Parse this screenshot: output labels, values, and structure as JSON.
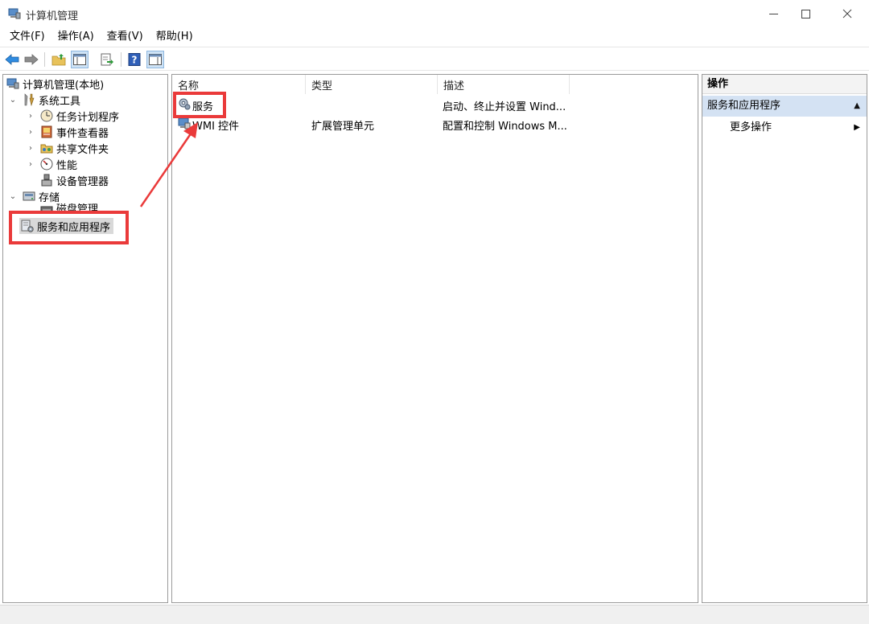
{
  "window": {
    "title": "计算机管理",
    "app_icon": "computer-management-icon"
  },
  "menu": [
    {
      "label": "文件(F)"
    },
    {
      "label": "操作(A)"
    },
    {
      "label": "查看(V)"
    },
    {
      "label": "帮助(H)"
    }
  ],
  "toolbar": {
    "icons": [
      "back-arrow-icon",
      "forward-arrow-icon",
      "up-folder-icon",
      "show-hide-tree-icon",
      "export-list-icon",
      "help-icon",
      "show-hide-action-pane-icon"
    ]
  },
  "tree": {
    "root": "计算机管理(本地)",
    "system_tools": "系统工具",
    "task_scheduler": "任务计划程序",
    "event_viewer": "事件查看器",
    "shared_folders": "共享文件夹",
    "performance": "性能",
    "device_manager": "设备管理器",
    "storage": "存储",
    "disk_management": "磁盘管理",
    "services_apps": "服务和应用程序"
  },
  "list": {
    "columns": {
      "name": "名称",
      "type": "类型",
      "description": "描述"
    },
    "rows": [
      {
        "name": "服务",
        "type": "",
        "description": "启动、终止并设置 Wind..."
      },
      {
        "name": "WMI 控件",
        "type": "扩展管理单元",
        "description": "配置和控制 Windows M..."
      }
    ]
  },
  "actions": {
    "header": "操作",
    "section": "服务和应用程序",
    "more": "更多操作"
  },
  "annotation_color": "#ea3a3a",
  "selection_color": "#d4e2f3"
}
